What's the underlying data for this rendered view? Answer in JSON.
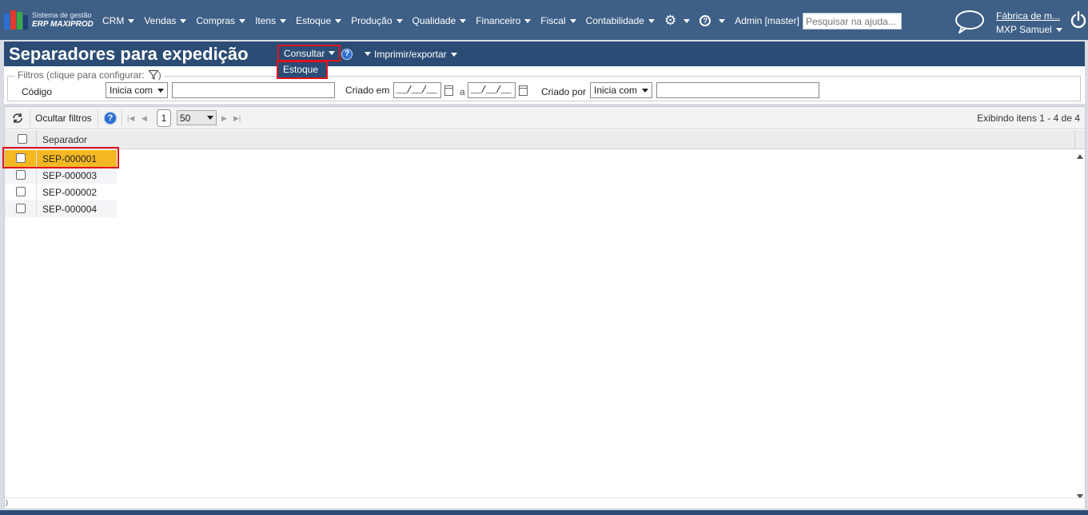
{
  "app": {
    "logo_line1": "Sistema de gestão",
    "logo_line2": "ERP MAXIPROD",
    "nav": [
      "CRM",
      "Vendas",
      "Compras",
      "Itens",
      "Estoque",
      "Produção",
      "Qualidade",
      "Financeiro",
      "Fiscal",
      "Contabilidade"
    ],
    "admin_label": "Admin [master]",
    "search_placeholder": "Pesquisar na ajuda...",
    "company": "Fábrica de m...",
    "user": "MXP Samuel"
  },
  "page": {
    "title": "Separadores para expedição",
    "consultar_label": "Consultar",
    "imprimir_label": "Imprimir/exportar",
    "dropdown_item": "Estoque"
  },
  "filters": {
    "legend": "Filtros (clique para configurar:",
    "legend_close": ")",
    "codigo_label": "Código",
    "codigo_op": "Inicia com",
    "criado_em_label": "Criado em",
    "date_from": "__/__/__",
    "date_sep": "a",
    "date_to": "__/__/__",
    "criado_por_label": "Criado por",
    "criado_por_op": "Inicia com"
  },
  "grid": {
    "ocultar_label": "Ocultar filtros",
    "help_label": "?",
    "page": "1",
    "per_page": "50",
    "range_text": "Exibindo itens 1 - 4 de 4",
    "column_header": "Separador",
    "rows": [
      "SEP-000001",
      "SEP-000003",
      "SEP-000002",
      "SEP-000004"
    ],
    "selected_row_color": "#f4b823",
    "hscroll_mark": ")"
  },
  "colors": {
    "topbar": "#3e5f86",
    "pagebar": "#2b4c74",
    "highlight": "#e0141d"
  }
}
